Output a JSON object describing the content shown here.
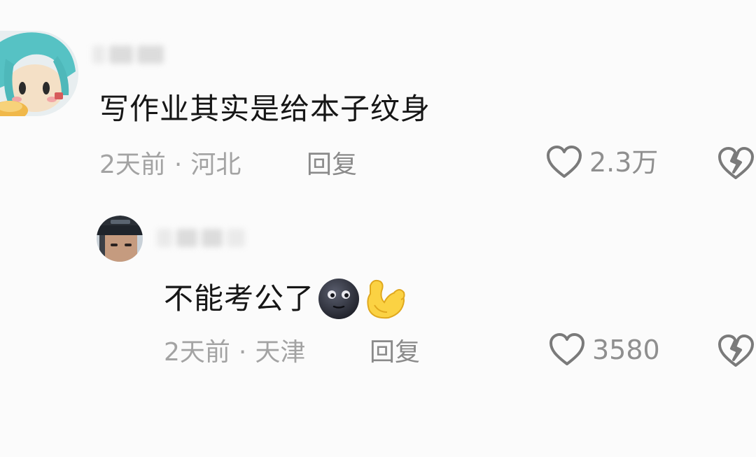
{
  "comments": [
    {
      "text": "写作业其实是给本子纹身",
      "time": "2天前",
      "separator": "·",
      "location": "河北",
      "reply_label": "回复",
      "likes": "2.3万"
    },
    {
      "text": "不能考公了",
      "emojis": [
        "new-moon-face-emoji",
        "flexed-biceps-emoji"
      ],
      "time": "2天前",
      "separator": "·",
      "location": "天津",
      "reply_label": "回复",
      "likes": "3580"
    }
  ],
  "colors": {
    "background": "#fbfbfb",
    "comment_text": "#161616",
    "meta_text": "#a3a3a3",
    "icon_stroke": "#7a7a7a"
  },
  "icons": {
    "like": "heart-outline-icon",
    "dislike": "broken-heart-icon"
  }
}
